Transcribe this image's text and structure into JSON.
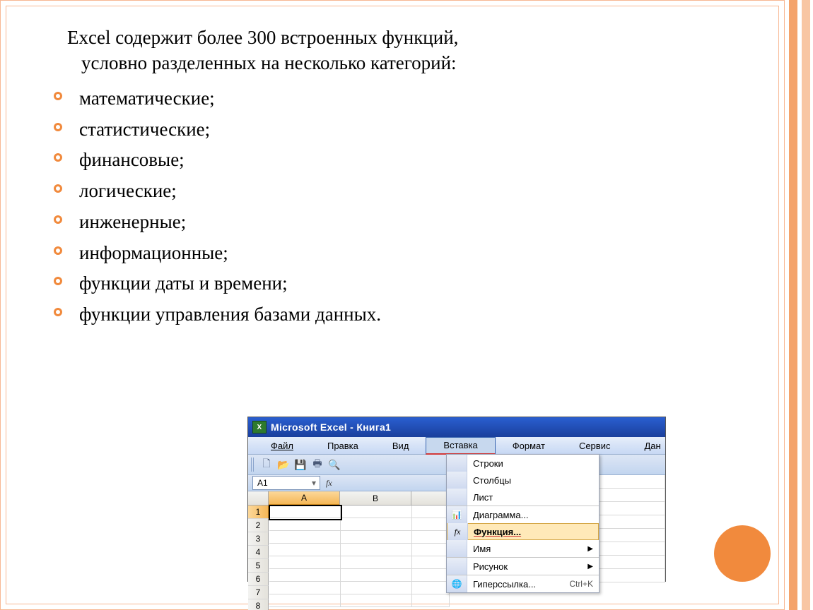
{
  "paragraph": {
    "line1": "Excel содержит более 300 встроенных функций,",
    "line2": "условно разделенных на несколько категорий:"
  },
  "bullets": [
    "математические;",
    "статистические;",
    "финансовые;",
    "логические;",
    "инженерные;",
    "информационные;",
    "функции даты и времени;",
    "функции управления базами данных."
  ],
  "excel": {
    "title": "Microsoft Excel - Книга1",
    "app_icon": "X",
    "menus": {
      "file": "Файл",
      "edit": "Правка",
      "view": "Вид",
      "insert": "Вставка",
      "format": "Формат",
      "tools": "Сервис",
      "data": "Дан"
    },
    "namebox": "A1",
    "fx_label": "fx",
    "columns": [
      "A",
      "B"
    ],
    "rows": [
      "1",
      "2",
      "3",
      "4",
      "5",
      "6",
      "7",
      "8"
    ],
    "dropdown": {
      "rows": "Строки",
      "cols": "Столбцы",
      "sheet": "Лист",
      "chart": "Диаграмма...",
      "func": "Функция...",
      "name": "Имя",
      "pic": "Рисунок",
      "link": "Гиперссылка...",
      "link_kb": "Ctrl+K",
      "chart_icon": "📊",
      "func_icon": "fx",
      "link_icon": "🌐"
    }
  }
}
